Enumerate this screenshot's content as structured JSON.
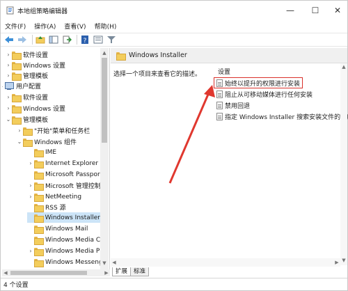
{
  "window": {
    "title": "本地组策略编辑器",
    "controls": {
      "minimize": "—",
      "maximize": "☐",
      "close": "✕"
    }
  },
  "menu": [
    "文件(F)",
    "操作(A)",
    "查看(V)",
    "帮助(H)"
  ],
  "toolbar": {
    "icons": [
      "back-arrow-icon",
      "forward-arrow-icon",
      "folder-up-icon",
      "show-tree-icon",
      "export-icon",
      "help-icon",
      "properties-icon",
      "filter-icon"
    ]
  },
  "tree": {
    "items": [
      {
        "label": "软件设置",
        "expander": "›"
      },
      {
        "label": "Windows 设置",
        "expander": "›"
      },
      {
        "label": "管理模板",
        "expander": "›"
      },
      {
        "label": "用户配置",
        "expander": "⌄"
      },
      {
        "label": "软件设置",
        "expander": "›"
      },
      {
        "label": "Windows 设置",
        "expander": "›"
      },
      {
        "label": "管理模板",
        "expander": "⌄"
      },
      {
        "label": "\"开始\"菜单和任务栏",
        "expander": "›"
      },
      {
        "label": "Windows 组件",
        "expander": "⌄"
      },
      {
        "label": "IME",
        "expander": ""
      },
      {
        "label": "Internet Explorer",
        "expander": "›"
      },
      {
        "label": "Microsoft Passport",
        "expander": ""
      },
      {
        "label": "Microsoft 管理控制台",
        "expander": "›"
      },
      {
        "label": "NetMeeting",
        "expander": "›"
      },
      {
        "label": "RSS 源",
        "expander": ""
      },
      {
        "label": "Windows Installer",
        "expander": ""
      },
      {
        "label": "Windows Mail",
        "expander": ""
      },
      {
        "label": "Windows Media Ce",
        "expander": ""
      },
      {
        "label": "Windows Media Pla",
        "expander": "›"
      },
      {
        "label": "Windows Messenge",
        "expander": ""
      }
    ],
    "selected": "Windows Installer"
  },
  "right_pane": {
    "header_title": "Windows Installer",
    "description": "选择一个项目来查看它的描述。",
    "column_header": "设置",
    "settings": [
      "始终以提升的权限进行安装",
      "阻止从可移动媒体进行任何安装",
      "禁用回退",
      "指定 Windows Installer 搜索安装文件的顺序"
    ],
    "highlighted_setting": "始终以提升的权限进行安装",
    "highlight_color": "#d9302a"
  },
  "tabs": [
    "扩展",
    "标准"
  ],
  "status": "4 个设置"
}
